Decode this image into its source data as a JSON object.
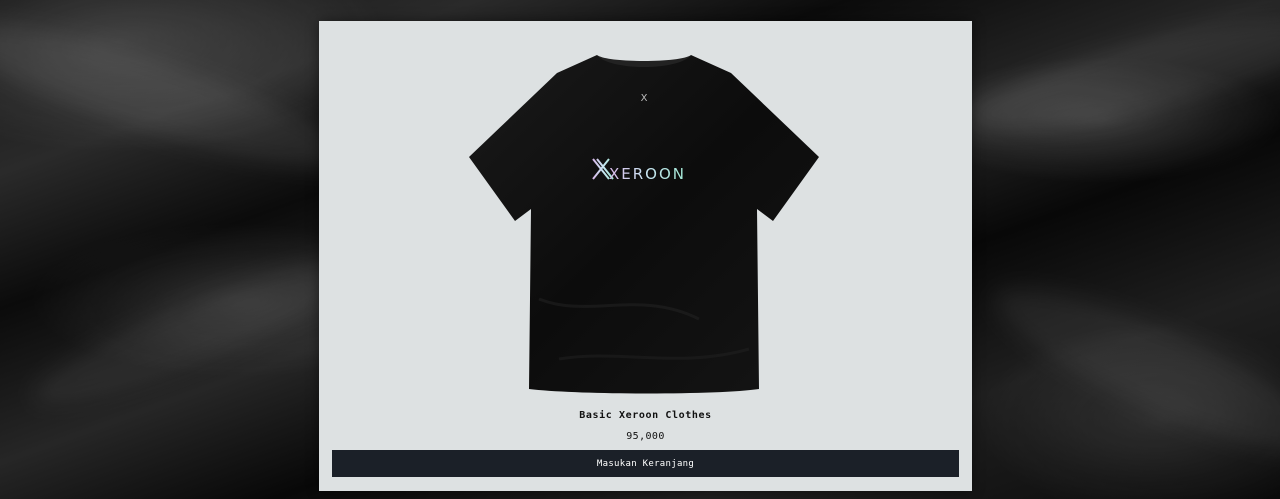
{
  "background": {
    "description_icon": "black-satin-fabric"
  },
  "product": {
    "image_icon": "black-tshirt-image",
    "brand_text": "XEROON",
    "collar_logo": "X",
    "name": "Basic Xeroon Clothes",
    "price": "95,000",
    "button_label": "Masukan Keranjang"
  },
  "colors": {
    "card_background": "#dde1e2",
    "button_background": "#1b2028",
    "button_text": "#ffffff",
    "shirt": "#0d0d0d"
  }
}
